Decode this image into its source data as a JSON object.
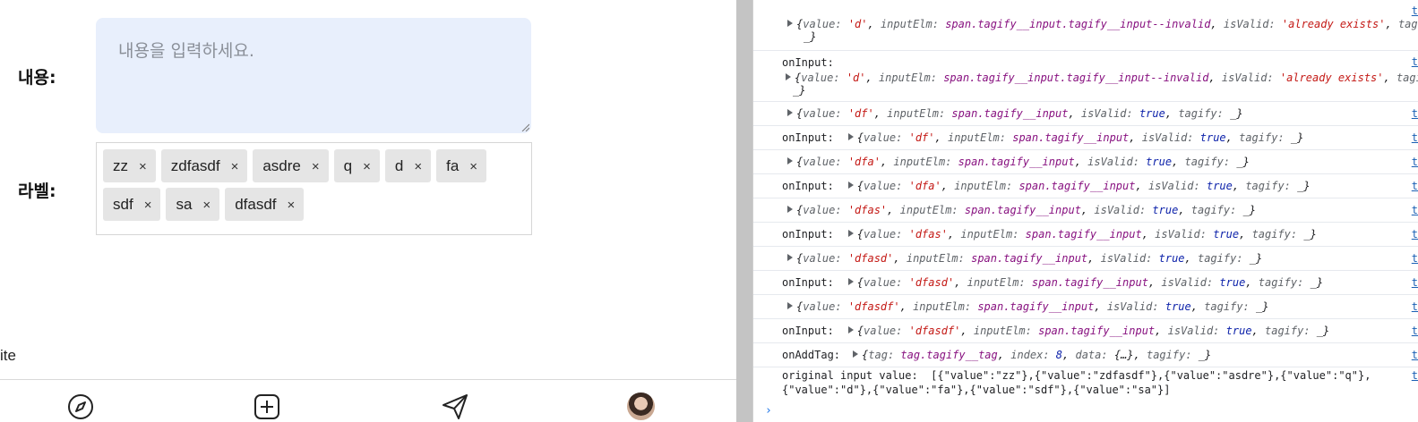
{
  "form": {
    "content_label": "내용:",
    "content_placeholder": "내용을 입력하세요.",
    "label_label": "라벨:",
    "tags": [
      "zz",
      "zdfasdf",
      "asdre",
      "q",
      "d",
      "fa",
      "sdf",
      "sa",
      "dfasdf"
    ],
    "tag_remove_glyph": "×",
    "truncated_text": "ite"
  },
  "bottom_nav": [
    "compass-icon",
    "plus-square-icon",
    "send-icon",
    "avatar"
  ],
  "console": {
    "rows": [
      {
        "prefix": "",
        "object": {
          "value": "'d'",
          "inputElm": "span.tagify__input.tagify__input--invalid",
          "isValid": "'already exists'",
          "tagify": "_"
        },
        "wrap_tail": "_}"
      },
      {
        "prefix": "onInput:",
        "object": {
          "value": "'d'",
          "inputElm": "span.tagify__input.tagify__input--invalid",
          "isValid": "'already exists'",
          "tagify": "_"
        },
        "wrap_tail": "_}"
      },
      {
        "prefix": "",
        "object": {
          "value": "'df'",
          "inputElm": "span.tagify__input",
          "isValid": "true",
          "tagify": "_"
        }
      },
      {
        "prefix": "onInput:",
        "object": {
          "value": "'df'",
          "inputElm": "span.tagify__input",
          "isValid": "true",
          "tagify": "_"
        }
      },
      {
        "prefix": "",
        "object": {
          "value": "'dfa'",
          "inputElm": "span.tagify__input",
          "isValid": "true",
          "tagify": "_"
        }
      },
      {
        "prefix": "onInput:",
        "object": {
          "value": "'dfa'",
          "inputElm": "span.tagify__input",
          "isValid": "true",
          "tagify": "_"
        }
      },
      {
        "prefix": "",
        "object": {
          "value": "'dfas'",
          "inputElm": "span.tagify__input",
          "isValid": "true",
          "tagify": "_"
        }
      },
      {
        "prefix": "onInput:",
        "object": {
          "value": "'dfas'",
          "inputElm": "span.tagify__input",
          "isValid": "true",
          "tagify": "_"
        }
      },
      {
        "prefix": "",
        "object": {
          "value": "'dfasd'",
          "inputElm": "span.tagify__input",
          "isValid": "true",
          "tagify": "_"
        }
      },
      {
        "prefix": "onInput:",
        "object": {
          "value": "'dfasd'",
          "inputElm": "span.tagify__input",
          "isValid": "true",
          "tagify": "_"
        }
      },
      {
        "prefix": "",
        "object": {
          "value": "'dfasdf'",
          "inputElm": "span.tagify__input",
          "isValid": "true",
          "tagify": "_"
        }
      },
      {
        "prefix": "onInput:",
        "object": {
          "value": "'dfasdf'",
          "inputElm": "span.tagify__input",
          "isValid": "true",
          "tagify": "_"
        }
      },
      {
        "prefix": "onAddTag:",
        "object": {
          "tag": "tag.tagify__tag",
          "index": "8",
          "data": "{…}",
          "tagify": "_"
        }
      }
    ],
    "final_line_1": "original input value:  [{\"value\":\"zz\"},{\"value\":\"zdfasdf\"},{\"value\":\"asdre\"},{\"value\":\"q\"},",
    "final_line_2": "{\"value\":\"d\"},{\"value\":\"fa\"},{\"value\":\"sdf\"},{\"value\":\"sa\"}]",
    "source_link": "t",
    "prompt_glyph": "›"
  },
  "colors": {
    "textarea_bg": "#e8effc",
    "tag_bg": "#e5e5e5",
    "string": "#c41a16",
    "key": "#5f6368",
    "keyword": "#0d22aa",
    "number": "#0d22aa"
  }
}
